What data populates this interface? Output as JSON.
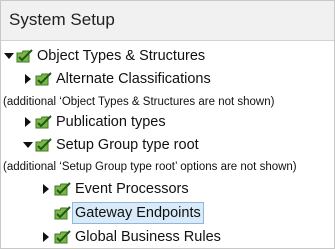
{
  "panel": {
    "title": "System Setup"
  },
  "tree": [
    {
      "label": "Object Types & Structures",
      "icon": "folder-check-icon",
      "expanded": true,
      "level": 0
    },
    {
      "label": "Alternate Classifications",
      "icon": "folder-check-icon",
      "expanded": false,
      "level": 1
    },
    {
      "note": "(additional ‘Object Types & Structures are not shown)"
    },
    {
      "label": "Publication types",
      "icon": "folder-check-icon",
      "expanded": false,
      "level": 1
    },
    {
      "label": "Setup Group type root",
      "icon": "folder-check-icon",
      "expanded": true,
      "level": 1
    },
    {
      "note": "(additional ‘Setup Group type root’ options are not shown)"
    },
    {
      "label": "Event Processors",
      "icon": "folder-check-icon",
      "expanded": false,
      "level": 2
    },
    {
      "label": "Gateway Endpoints",
      "icon": "folder-check-icon",
      "level": 2,
      "selected": true
    },
    {
      "label": "Global Business Rules",
      "icon": "folder-check-icon",
      "expanded": false,
      "level": 2
    }
  ],
  "colors": {
    "folder": "#7bb54a",
    "folder_dark": "#3f7a22",
    "selection": "#d9ebf9",
    "selection_border": "#8fb6dc"
  }
}
